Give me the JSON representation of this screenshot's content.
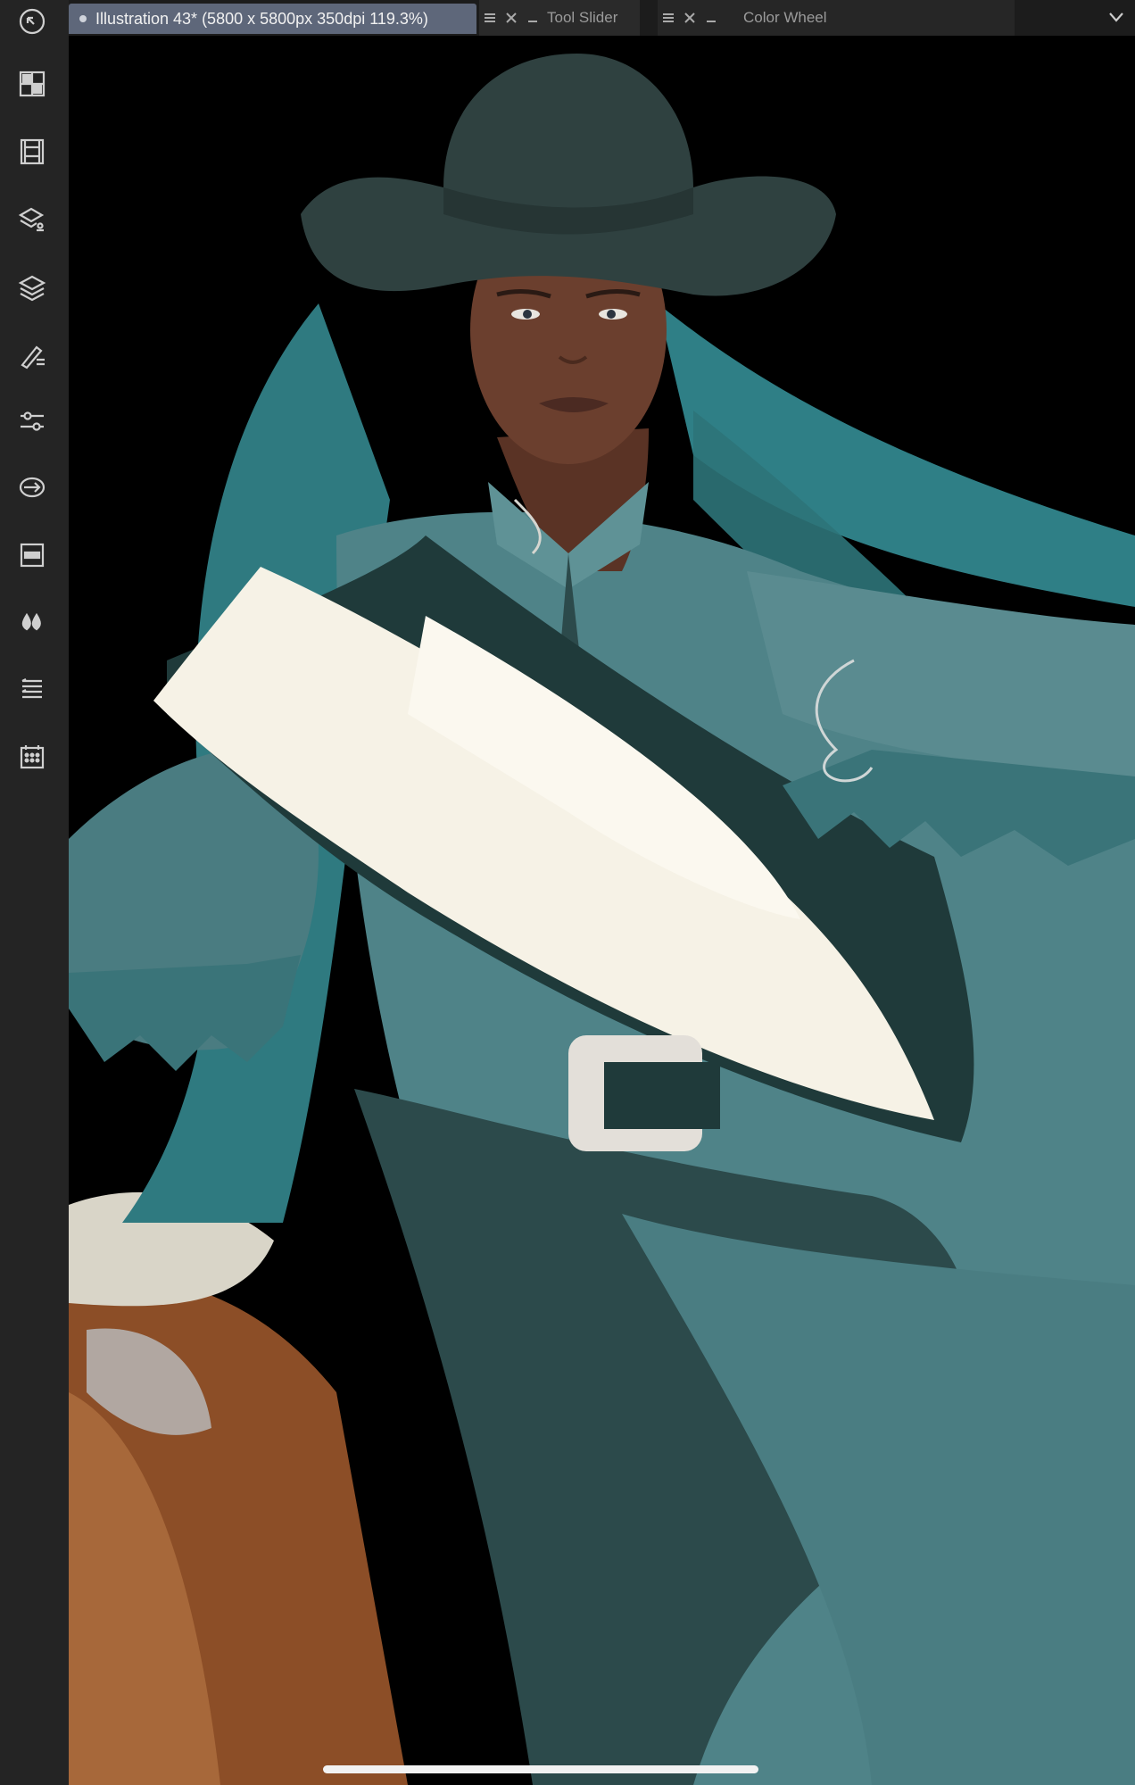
{
  "document_tab": {
    "title": "Illustration 43* (5800 x 5800px 350dpi 119.3%)"
  },
  "panels": [
    {
      "label": "Tool Slider"
    },
    {
      "label": "Color Wheel"
    }
  ],
  "rail_icons": [
    "app-logo-icon",
    "sub-tool-grid-icon",
    "animation-timeline-icon",
    "materials-icon",
    "layers-icon",
    "tool-property-brush-icon",
    "adjustment-sliders-icon",
    "transform-arrow-icon",
    "navigator-icon",
    "color-drops-icon",
    "layer-property-list-icon",
    "calendar-grid-icon"
  ],
  "colors": {
    "rail_bg": "#242424",
    "active_tab": "#5e677a",
    "canvas_bg": "#000000",
    "teal_main": "#4f8388",
    "teal_dark": "#2c4a4b",
    "hat": "#2f4140",
    "sash": "#f6f2e6",
    "skin": "#6b3f2e",
    "saddle": "#9a5a2e"
  }
}
